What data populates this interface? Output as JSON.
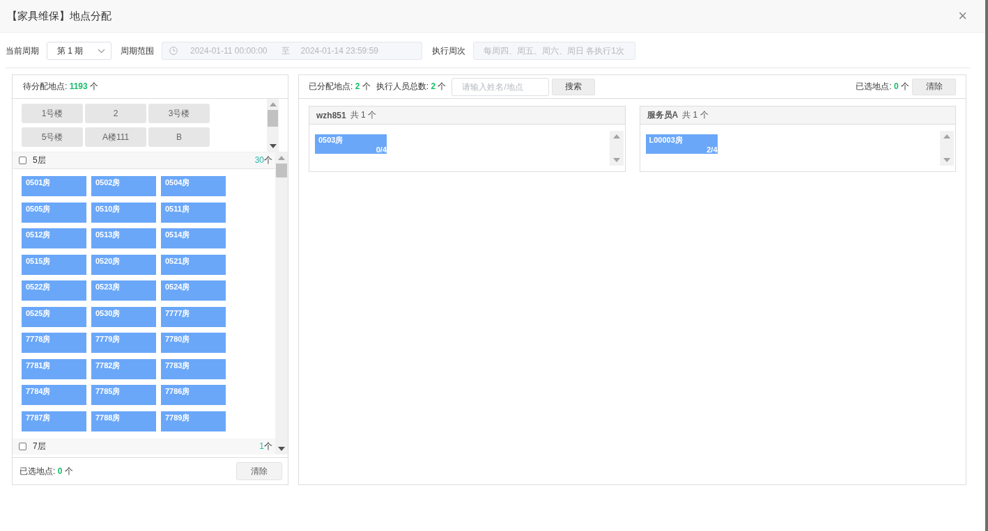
{
  "dialog": {
    "title": "【家具维保】地点分配",
    "close": "×"
  },
  "period": {
    "label": "当前周期",
    "value": "第 1 期"
  },
  "range": {
    "label": "周期范围",
    "start": "2024-01-11 00:00:00",
    "separator": "至",
    "end": "2024-01-14 23:59:59",
    "disabled": true
  },
  "frequency": {
    "label": "执行周次",
    "value": "每周四、周五、周六、周日 各执行1次",
    "disabled": true
  },
  "pending": {
    "label": "待分配地点:",
    "count": "1193",
    "unit": "个",
    "buildings": [
      {
        "label": "1号楼",
        "selected": false
      },
      {
        "label": "2",
        "selected": false
      },
      {
        "label": "3号楼",
        "selected": false
      },
      {
        "label": "5号楼",
        "selected": false
      },
      {
        "label": "A楼111",
        "selected": false
      },
      {
        "label": "B",
        "selected": false
      }
    ],
    "floors": [
      {
        "name": "5层",
        "checked": false,
        "count": "30",
        "unit": "个",
        "rooms": [
          "0501房",
          "0502房",
          "0504房",
          "0505房",
          "0510房",
          "0511房",
          "0512房",
          "0513房",
          "0514房",
          "0515房",
          "0520房",
          "0521房",
          "0522房",
          "0523房",
          "0524房",
          "0525房",
          "0530房",
          "7777房",
          "7778房",
          "7779房",
          "7780房",
          "7781房",
          "7782房",
          "7783房",
          "7784房",
          "7785房",
          "7786房",
          "7787房",
          "7788房",
          "7789房"
        ]
      },
      {
        "name": "7层",
        "checked": false,
        "count": "1",
        "unit": "个"
      }
    ],
    "footer": {
      "label": "已选地点:",
      "count": "0",
      "unit": "个",
      "clear": "清除"
    }
  },
  "assigned": {
    "summary": [
      {
        "label": "已分配地点:",
        "count": "2",
        "unit": "个"
      },
      {
        "label": "执行人员总数:",
        "count": "2",
        "unit": "个"
      }
    ],
    "search": {
      "placeholder": "请输入姓名/地点",
      "button": "搜索"
    },
    "selected": {
      "label": "已选地点:",
      "count": "0",
      "unit": "个",
      "clear": "清除"
    },
    "workers": [
      {
        "name": "wzh851",
        "total": "共 1 个",
        "locations": [
          {
            "name": "0503房",
            "ratio": "0/4"
          }
        ]
      },
      {
        "name": "服务员A",
        "total": "共 1 个",
        "locations": [
          {
            "name": "L00003房",
            "ratio": "2/4"
          }
        ]
      }
    ]
  }
}
